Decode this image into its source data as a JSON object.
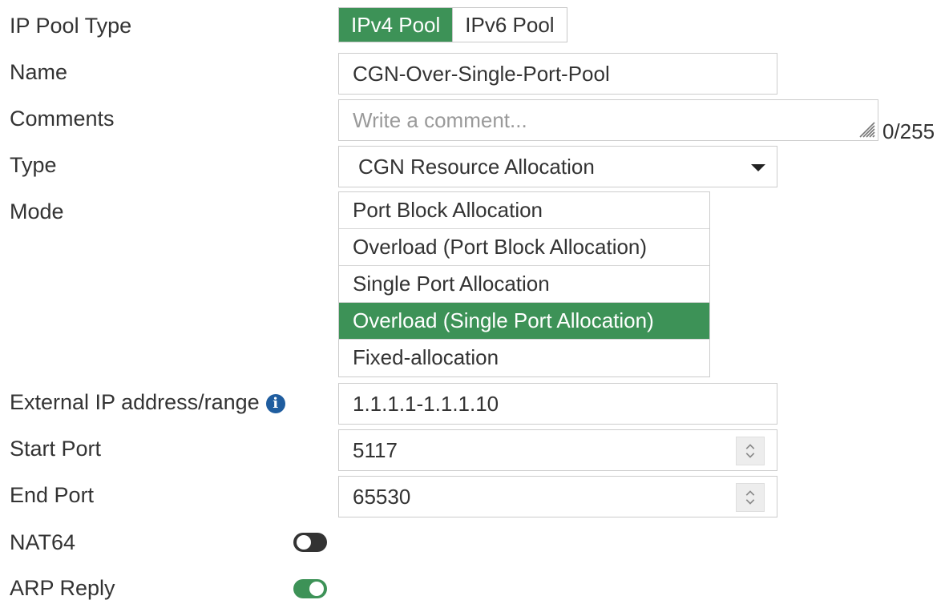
{
  "labels": {
    "ip_pool_type": "IP Pool Type",
    "name": "Name",
    "comments": "Comments",
    "type": "Type",
    "mode": "Mode",
    "external_ip": "External IP address/range",
    "start_port": "Start Port",
    "end_port": "End Port",
    "nat64": "NAT64",
    "arp_reply": "ARP Reply"
  },
  "ip_pool_type": {
    "options": [
      "IPv4 Pool",
      "IPv6 Pool"
    ],
    "selected": "IPv4 Pool"
  },
  "name": {
    "value": "CGN-Over-Single-Port-Pool"
  },
  "comments": {
    "placeholder": "Write a comment...",
    "counter": "0/255"
  },
  "type": {
    "value": "CGN Resource Allocation"
  },
  "mode": {
    "options": [
      "Port Block Allocation",
      "Overload (Port Block Allocation)",
      "Single Port Allocation",
      "Overload (Single Port Allocation)",
      "Fixed-allocation"
    ],
    "selected": "Overload (Single Port Allocation)"
  },
  "external_ip": {
    "value": "1.1.1.1-1.1.1.10",
    "icon": "info-icon"
  },
  "start_port": {
    "value": "5117"
  },
  "end_port": {
    "value": "65530"
  },
  "nat64": {
    "enabled": false
  },
  "arp_reply": {
    "enabled": true
  },
  "colors": {
    "accent_green": "#3d9257",
    "info_blue": "#1f5d9f",
    "toggle_off": "#333333",
    "border": "#cccccc",
    "text": "#333333",
    "placeholder": "#9a9a9a"
  }
}
